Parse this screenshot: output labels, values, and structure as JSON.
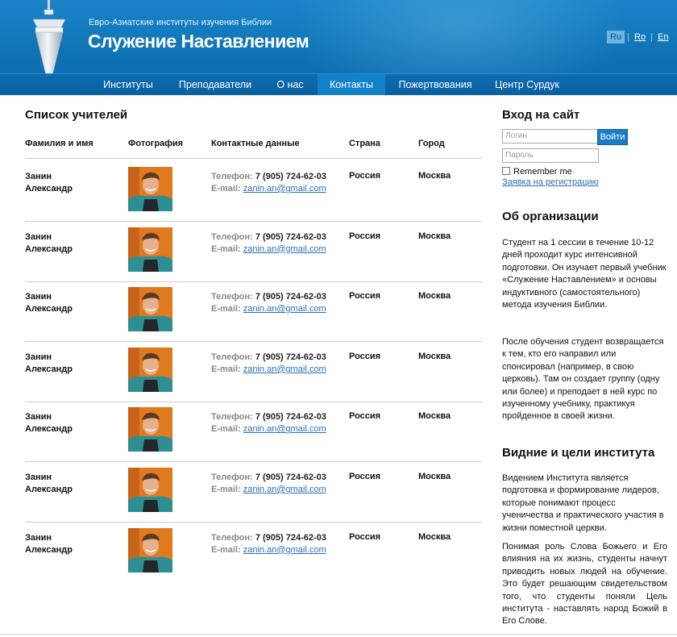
{
  "header": {
    "tagline": "Евро-Азиатские институты изучения Библии",
    "title": "Служение Наставлением",
    "languages": [
      {
        "code": "Ru",
        "selected": true
      },
      {
        "code": "Ro",
        "selected": false
      },
      {
        "code": "En",
        "selected": false
      }
    ]
  },
  "nav": [
    {
      "label": "Институты",
      "active": false
    },
    {
      "label": "Преподаватели",
      "active": false
    },
    {
      "label": "О нас",
      "active": false
    },
    {
      "label": "Контакты",
      "active": true
    },
    {
      "label": "Пожертвования",
      "active": false
    },
    {
      "label": "Центр Сурдук",
      "active": false
    }
  ],
  "teachers": {
    "title": "Список учителей",
    "columns": {
      "name": "Фамилия и имя",
      "photo": "Фотография",
      "contact": "Контактные данные",
      "country": "Страна",
      "city": "Город"
    },
    "phone_label": "Телефон:",
    "email_label": "E-mail:",
    "rows": [
      {
        "surname": "Занин",
        "first_name": "Александр",
        "phone": "7 (905) 724-62-03",
        "email": "zanin.an@gmail.com",
        "country": "Россия",
        "city": "Москва"
      },
      {
        "surname": "Занин",
        "first_name": "Александр",
        "phone": "7 (905) 724-62-03",
        "email": "zanin.an@gmail.com",
        "country": "Россия",
        "city": "Москва"
      },
      {
        "surname": "Занин",
        "first_name": "Александр",
        "phone": "7 (905) 724-62-03",
        "email": "zanin.an@gmail.com",
        "country": "Россия",
        "city": "Москва"
      },
      {
        "surname": "Занин",
        "first_name": "Александр",
        "phone": "7 (905) 724-62-03",
        "email": "zanin.an@gmail.com",
        "country": "Россия",
        "city": "Москва"
      },
      {
        "surname": "Занин",
        "first_name": "Александр",
        "phone": "7 (905) 724-62-03",
        "email": "zanin.an@gmail.com",
        "country": "Россия",
        "city": "Москва"
      },
      {
        "surname": "Занин",
        "first_name": "Александр",
        "phone": "7 (905) 724-62-03",
        "email": "zanin.an@gmail.com",
        "country": "Россия",
        "city": "Москва"
      },
      {
        "surname": "Занин",
        "first_name": "Александр",
        "phone": "7 (905) 724-62-03",
        "email": "zanin.an@gmail.com",
        "country": "Россия",
        "city": "Москва"
      }
    ]
  },
  "sidebar": {
    "login": {
      "title": "Вход на сайт",
      "login_placeholder": "Логин",
      "password_placeholder": "Пароль",
      "button": "Войти",
      "remember": "Remember me",
      "register": "Заявка на регистрацию"
    },
    "about": {
      "title": "Об организации",
      "p1": "Студент на 1 сессии в течение 10-12 дней проходит курс интенсивной подготовки. Он изучает первый учебник «Служение Наставлением» и основы индуктивного (самостоятельного) метода изучения Библии.",
      "p2": "После обучения студент возвращается к тем, кто его направил или спонсировал (например, в свою церковь). Там он создает группу (одну или более) и преподает в ней курс по изученному учебнику, практикуя пройденное в своей жизни."
    },
    "vision": {
      "title": "Видние и цели института",
      "p1": "Видением Института является подготовка и формирование лидеров, которые понимают процесс ученичества и практического участия в жизни поместной церкви.",
      "p2": "Понимая роль Слова Божьего и Его влияния на их жизнь, студенты начнут приводить новых людей на обучение. Это будет решающим свидетельством того, что студенты поняли Цель института - наставлять народ Божий в Его Слове."
    }
  },
  "colors": {
    "header_blue": "#0f74b6",
    "nav_active": "#1282c8",
    "link": "#2a6fb6"
  }
}
